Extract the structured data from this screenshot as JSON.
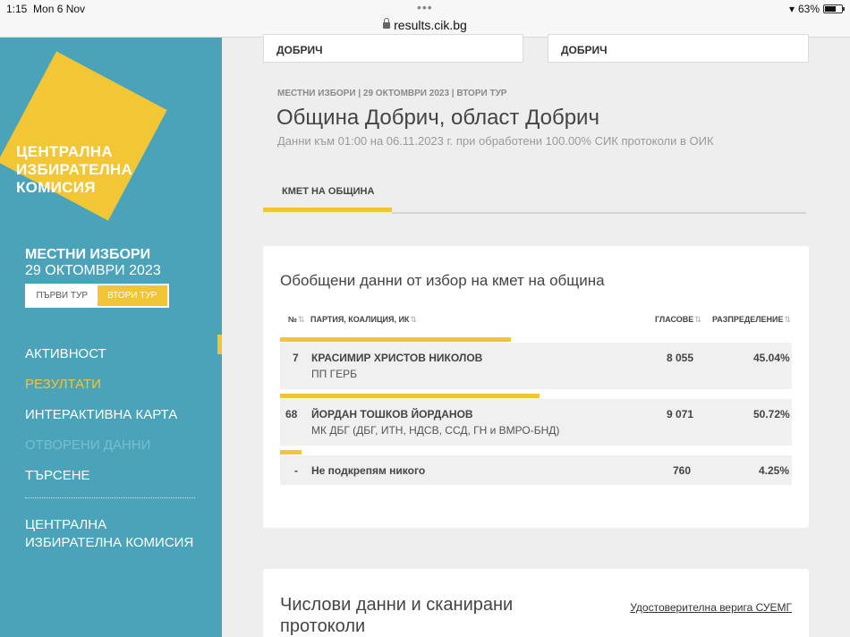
{
  "status": {
    "time": "1:15",
    "date": "Mon 6 Nov",
    "battery": "63%",
    "url": "results.cik.bg"
  },
  "sidebar": {
    "logo": [
      "ЦЕНТРАЛНА",
      "ИЗБИРАТЕЛНА",
      "КОМИСИЯ"
    ],
    "elections_title": "МЕСТНИ ИЗБОРИ",
    "elections_date": "29 ОКТОМВРИ 2023",
    "rounds": [
      "ПЪРВИ ТУР",
      "ВТОРИ ТУР"
    ],
    "nav": [
      "АКТИВНОСТ",
      "РЕЗУЛТАТИ",
      "ИНТЕРАКТИВНА КАРТА",
      "ОТВОРЕНИ ДАННИ",
      "ТЪРСЕНЕ"
    ],
    "cik_link": "ЦЕНТРАЛНА ИЗБИРАТЕЛНА КОМИСИЯ"
  },
  "top_cards": [
    "ДОБРИЧ",
    "ДОБРИЧ"
  ],
  "header": {
    "breadcrumb": "МЕСТНИ ИЗБОРИ | 29 ОКТОМВРИ 2023 | ВТОРИ ТУР",
    "title": "Община Добрич, област Добрич",
    "subtitle": "Данни към 01:00 на 06.11.2023 г. при обработени 100.00% СИК протоколи в ОИК"
  },
  "tab": "КМЕТ НА ОБЩИНА",
  "summary": {
    "title": "Обобщени данни от избор на кмет на община",
    "columns": {
      "no": "№",
      "party": "ПАРТИЯ, КОАЛИЦИЯ, ИК",
      "votes": "ГЛАСОВЕ",
      "share": "РАЗПРЕДЕЛЕНИЕ"
    },
    "rows": [
      {
        "no": "7",
        "name": "КРАСИМИР ХРИСТОВ НИКОЛОВ",
        "party": "ПП ГЕРБ",
        "votes": "8 055",
        "share": "45.04%",
        "fraction": 0.4504
      },
      {
        "no": "68",
        "name": "ЙОРДАН ТОШКОВ ЙОРДАНОВ",
        "party": "МК ДБГ (ДБГ, ИТН, НДСВ, ССД, ГН и ВМРО-БНД)",
        "votes": "9 071",
        "share": "50.72%",
        "fraction": 0.5072
      },
      {
        "no": "-",
        "name": "Не подкрепям никого",
        "party": "",
        "votes": "760",
        "share": "4.25%",
        "fraction": 0.0425
      }
    ]
  },
  "protocols": {
    "title": "Числови данни и сканирани протоколи",
    "link": "Удостоверителна верига СУЕМГ"
  },
  "colors": {
    "accent": "#f2c534",
    "sidebar": "#4ba3b9"
  }
}
